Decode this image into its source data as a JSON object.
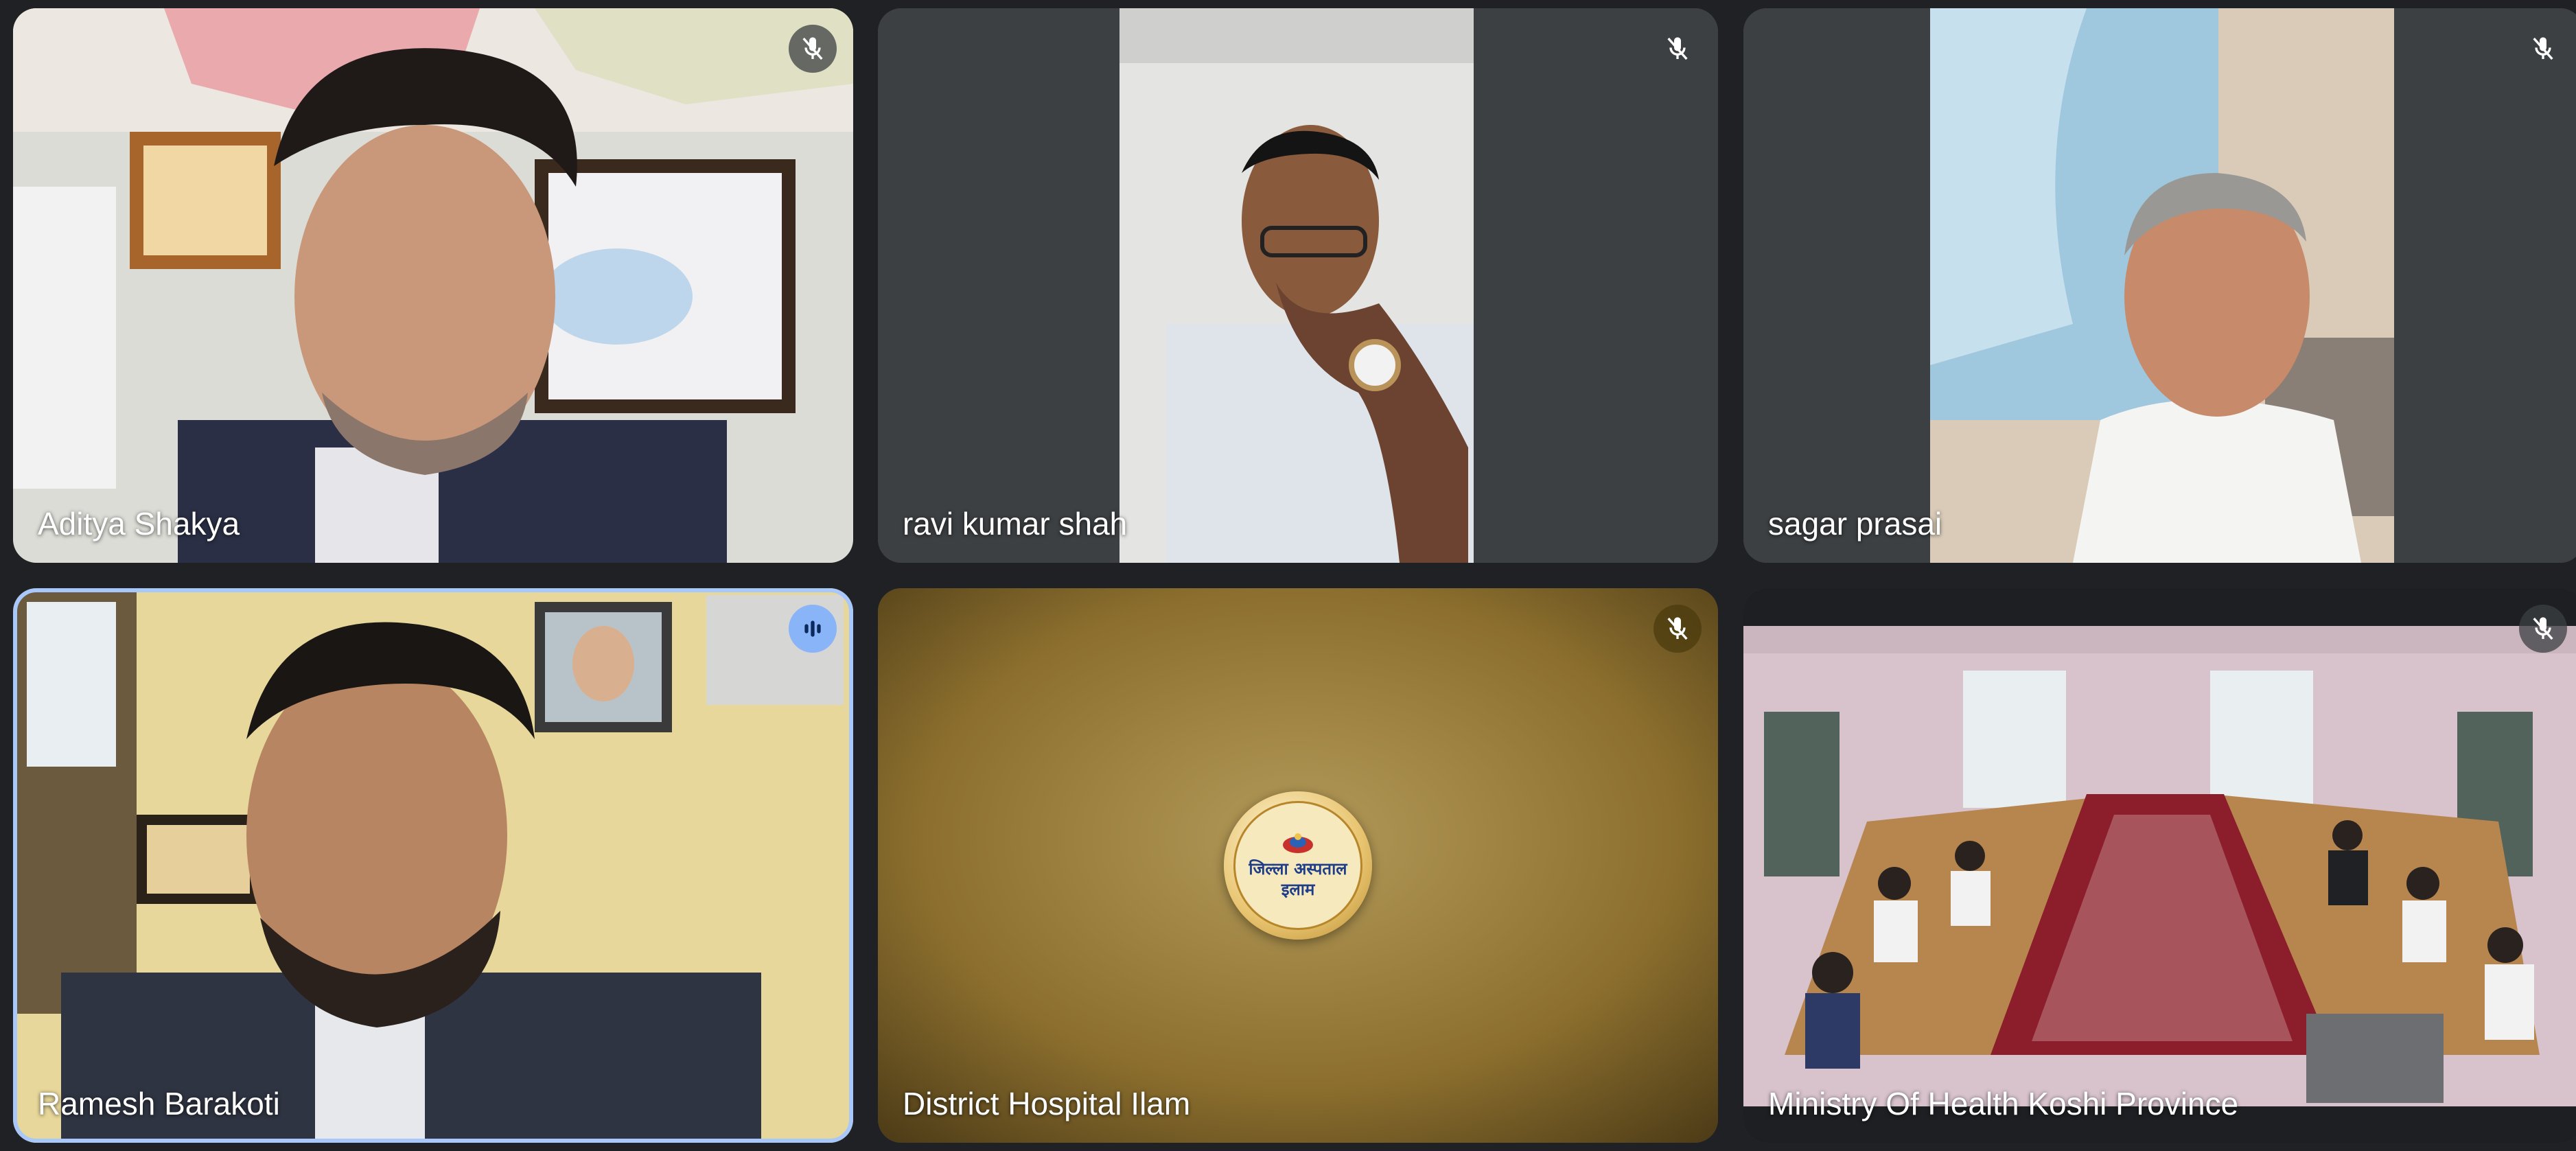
{
  "meeting": {
    "participants": [
      {
        "name": "Aditya Shakya",
        "muted": true
      },
      {
        "name": "ravi kumar shah",
        "muted": true
      },
      {
        "name": "sagar prasai",
        "muted": true
      },
      {
        "name": "Ramesh Barakoti",
        "speaking": true
      },
      {
        "name": "District Hospital Ilam",
        "muted": true
      },
      {
        "name": "Ministry Of Health Koshi Province",
        "muted": true
      }
    ],
    "hospital_logo": {
      "line1": "जिल्ला अस्पताल",
      "line2": "इलाम"
    }
  },
  "icons": {
    "muted": "mic-off-icon",
    "speaking": "audio-level-icon"
  },
  "colors": {
    "background": "#202124",
    "tile": "#3c4043",
    "active_border": "#a8c7fa",
    "speaking_indicator": "#8ab4f8"
  }
}
